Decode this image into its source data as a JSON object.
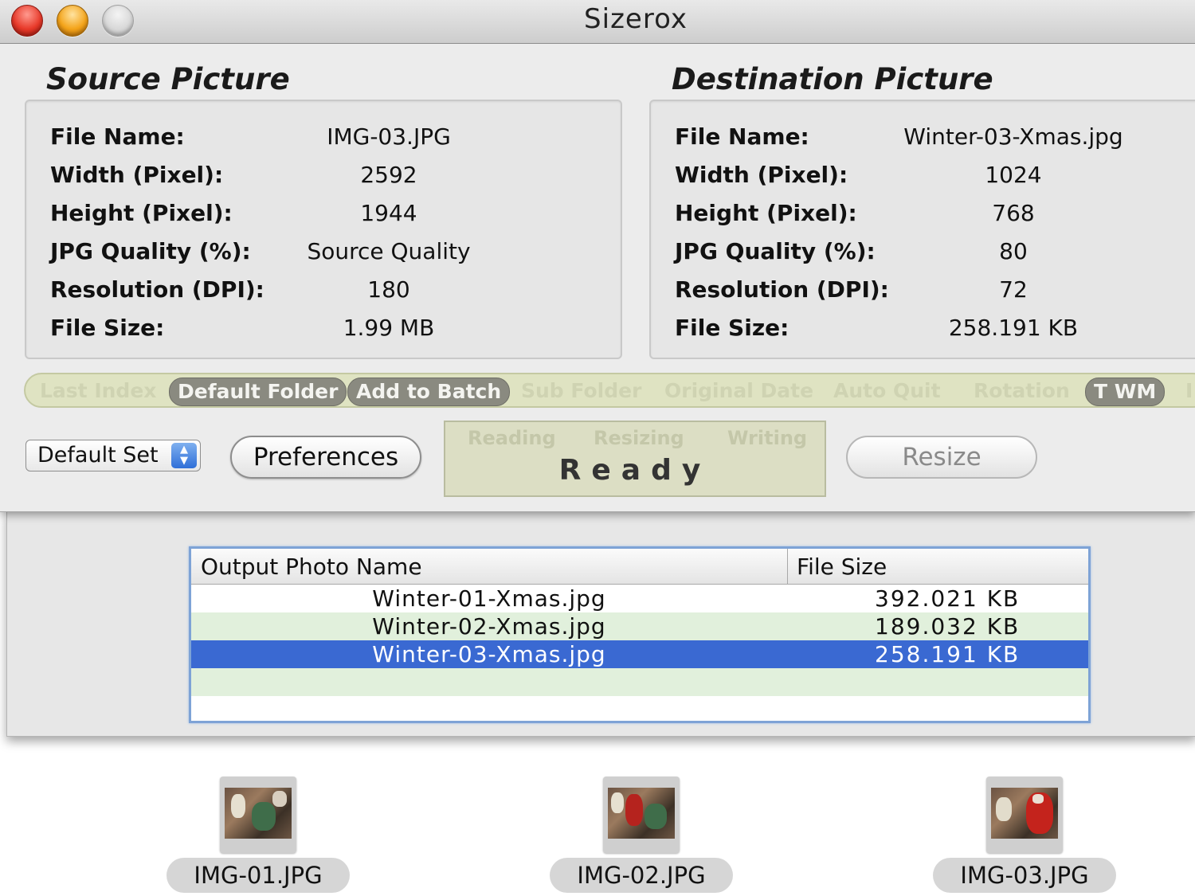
{
  "window": {
    "title": "Sizerox"
  },
  "source": {
    "heading": "Source Picture",
    "rows": [
      {
        "label": "File Name:",
        "value": "IMG-03.JPG"
      },
      {
        "label": "Width (Pixel):",
        "value": "2592"
      },
      {
        "label": "Height (Pixel):",
        "value": "1944"
      },
      {
        "label": "JPG Quality (%):",
        "value": "Source Quality"
      },
      {
        "label": "Resolution (DPI):",
        "value": "180"
      },
      {
        "label": "File Size:",
        "value": "1.99 MB"
      }
    ]
  },
  "destination": {
    "heading": "Destination Picture",
    "rows": [
      {
        "label": "File Name:",
        "value": "Winter-03-Xmas.jpg"
      },
      {
        "label": "Width (Pixel):",
        "value": "1024"
      },
      {
        "label": "Height (Pixel):",
        "value": "768"
      },
      {
        "label": "JPG Quality (%):",
        "value": "80"
      },
      {
        "label": "Resolution (DPI):",
        "value": "72"
      },
      {
        "label": "File Size:",
        "value": "258.191 KB"
      }
    ]
  },
  "options": [
    {
      "label": "Last Index",
      "active": false
    },
    {
      "label": "Default Folder",
      "active": true
    },
    {
      "label": "Add to Batch",
      "active": true
    },
    {
      "label": "Sub Folder",
      "active": false
    },
    {
      "label": "Original Date",
      "active": false
    },
    {
      "label": "Auto Quit",
      "active": false
    },
    {
      "label": "Rotation",
      "active": false
    },
    {
      "label": "T WM",
      "active": true
    },
    {
      "label": "I",
      "active": false
    }
  ],
  "controls": {
    "preset_value": "Default Set",
    "preferences_label": "Preferences",
    "resize_label": "Resize"
  },
  "status": {
    "stages": [
      "Reading",
      "Resizing",
      "Writing"
    ],
    "message": "Ready"
  },
  "batch_table": {
    "columns": [
      "Output Photo Name",
      "File Size"
    ],
    "rows": [
      {
        "name": "Winter-01-Xmas.jpg",
        "size": "392.021 KB"
      },
      {
        "name": "Winter-02-Xmas.jpg",
        "size": "189.032 KB"
      },
      {
        "name": "Winter-03-Xmas.jpg",
        "size": "258.191 KB",
        "selected": true
      }
    ]
  },
  "thumbnails": [
    {
      "name": "IMG-01.JPG"
    },
    {
      "name": "IMG-02.JPG"
    },
    {
      "name": "IMG-03.JPG"
    }
  ],
  "colors": {
    "selection": "#3a69d2",
    "stripe": "#e1f0dc",
    "options_bar": "#dfe3c2",
    "status_bg": "#dcdec4"
  }
}
